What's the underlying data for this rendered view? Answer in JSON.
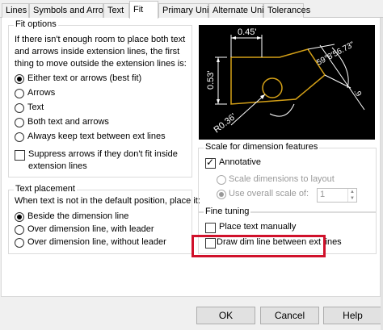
{
  "tabs": [
    "Lines",
    "Symbols and Arrows",
    "Text",
    "Fit",
    "Primary Units",
    "Alternate Units",
    "Tolerances"
  ],
  "fit_options": {
    "title": "Fit options",
    "description": "If there isn't enough room to place both text and arrows inside extension lines, the first thing to move outside the extension lines is:",
    "radios": [
      "Either text or arrows (best fit)",
      "Arrows",
      "Text",
      "Both text and arrows",
      "Always keep text between ext lines"
    ],
    "selected_index": 0,
    "suppress_label": "Suppress arrows if they don't fit inside extension lines",
    "suppress_checked": false
  },
  "text_placement": {
    "title": "Text placement",
    "description": "When text is not in the default position, place it:",
    "radios": [
      "Beside the dimension line",
      "Over dimension line, with leader",
      "Over dimension line, without leader"
    ],
    "selected_index": 0
  },
  "preview": {
    "dim_top": "0.45'",
    "dim_left": "0.53'",
    "dim_angle": "59°8'56.73\"",
    "dim_right": ".9",
    "dim_radius": "R0.36'",
    "colors": {
      "background": "#000000",
      "lines": "#ffffff",
      "geometry": "#d4a017"
    }
  },
  "scale": {
    "title": "Scale for dimension features",
    "annotative_label": "Annotative",
    "annotative_checked": true,
    "layout_label": "Scale dimensions to layout",
    "overall_label": "Use overall scale of:",
    "overall_selected": true,
    "overall_value": "1"
  },
  "fine_tuning": {
    "title": "Fine tuning",
    "place_text_label": "Place text manually",
    "place_text_checked": false,
    "draw_dim_label": "Draw dim line between ext lines",
    "draw_dim_checked": false,
    "highlight_color": "#d0112b"
  },
  "buttons": {
    "ok": "OK",
    "cancel": "Cancel",
    "help": "Help"
  }
}
